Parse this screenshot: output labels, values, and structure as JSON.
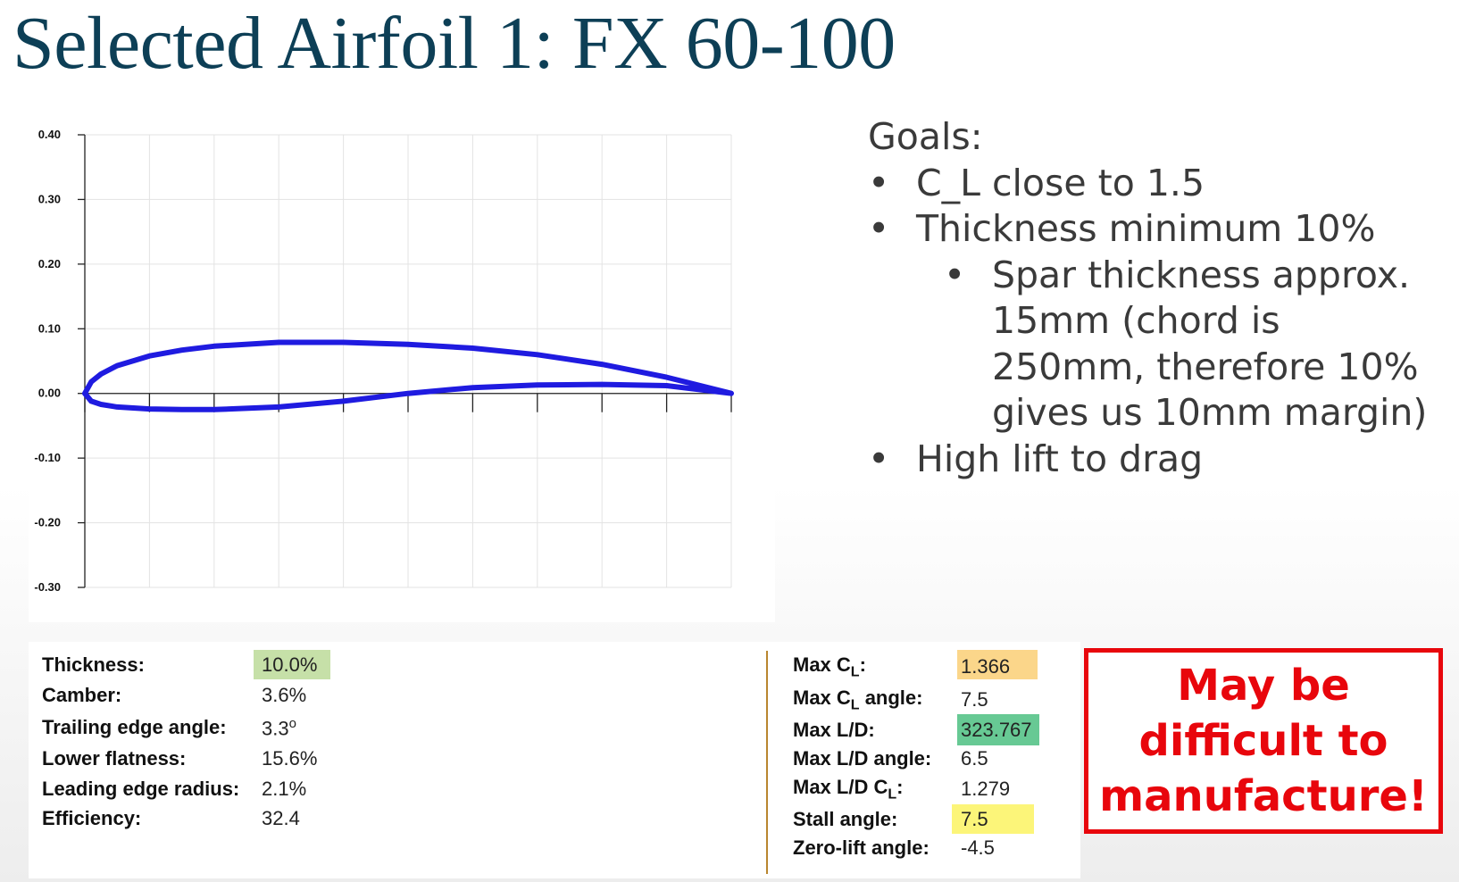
{
  "title": "Selected Airfoil 1: FX 60-100",
  "plot": {
    "y_tick_labels": [
      "0.40",
      "0.30",
      "0.20",
      "0.10",
      "0.00",
      "-0.10",
      "-0.20",
      "-0.30"
    ]
  },
  "chart_data": {
    "type": "line",
    "ylim": [
      -0.3,
      0.4
    ],
    "xlim": [
      0,
      1
    ],
    "y_ticks": [
      0.4,
      0.3,
      0.2,
      0.1,
      0.0,
      -0.1,
      -0.2,
      -0.3
    ],
    "series": [
      {
        "x": [
          1.0,
          0.9,
          0.8,
          0.7,
          0.6,
          0.5,
          0.4,
          0.3,
          0.2,
          0.15,
          0.1,
          0.05,
          0.025,
          0.01,
          0.0,
          0.01,
          0.025,
          0.05,
          0.1,
          0.15,
          0.2,
          0.3,
          0.4,
          0.5,
          0.6,
          0.7,
          0.8,
          0.9,
          1.0
        ],
        "y": [
          0.0,
          0.025,
          0.045,
          0.06,
          0.07,
          0.076,
          0.079,
          0.079,
          0.073,
          0.067,
          0.058,
          0.043,
          0.03,
          0.018,
          0.0,
          -0.012,
          -0.017,
          -0.021,
          -0.024,
          -0.025,
          -0.025,
          -0.021,
          -0.012,
          0.0,
          0.009,
          0.013,
          0.014,
          0.012,
          0.0
        ]
      }
    ],
    "grid": true,
    "line_color": "#1f1be0"
  },
  "goals": {
    "heading": "Goals:",
    "items": [
      {
        "level": 1,
        "text": "C_L close to 1.5"
      },
      {
        "level": 1,
        "text": "Thickness minimum 10%"
      },
      {
        "level": 2,
        "text": "Spar thickness approx. 15mm (chord is 250mm, therefore 10% gives us 10mm margin)"
      },
      {
        "level": 1,
        "text": "High lift to drag"
      }
    ]
  },
  "stats": {
    "left": [
      {
        "label": "Thickness:",
        "value": "10.0%",
        "highlight": "#c6e0a8"
      },
      {
        "label": "Camber:",
        "value": "3.6%"
      },
      {
        "label": "Trailing edge angle:",
        "value": "3.3°"
      },
      {
        "label": "Lower flatness:",
        "value": "15.6%"
      },
      {
        "label": "Leading edge radius:",
        "value": "2.1%"
      },
      {
        "label": "Efficiency:",
        "value": "32.4"
      }
    ],
    "right": [
      {
        "label": "Max CL:",
        "value": "1.366",
        "highlight": "#fbd68a"
      },
      {
        "label": "Max CL angle:",
        "value": "7.5"
      },
      {
        "label": "Max L/D:",
        "value": "323.767",
        "highlight": "#67c994"
      },
      {
        "label": "Max L/D angle:",
        "value": "6.5"
      },
      {
        "label": "Max L/D CL:",
        "value": "1.279"
      },
      {
        "label": "Stall angle:",
        "value": "7.5",
        "highlight": "#fcf579"
      },
      {
        "label": "Zero-lift angle:",
        "value": "-4.5"
      }
    ]
  },
  "warning": {
    "text": "May be difficult to manufacture!",
    "color": "#e8060c"
  }
}
